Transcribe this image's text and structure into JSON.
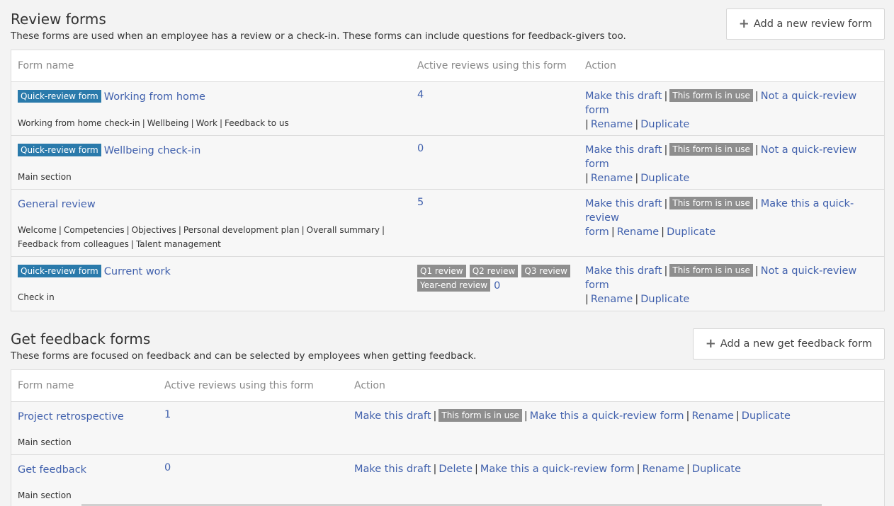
{
  "review": {
    "title": "Review forms",
    "description": "These forms are used when an employee has a review or a check-in. These forms can include questions for feedback-givers too.",
    "add_button": "Add a new review form",
    "headers": {
      "name": "Form name",
      "active": "Active reviews using this form",
      "action": "Action"
    },
    "rows": [
      {
        "badge": "Quick-review form",
        "name": "Working from home",
        "sections": [
          "Working from home check-in",
          "Wellbeing",
          "Work",
          "Feedback to us"
        ],
        "count": "4",
        "make_draft": "Make this draft",
        "in_use": "This form is in use",
        "quick": "Not a quick-review form",
        "rename": "Rename",
        "duplicate": "Duplicate"
      },
      {
        "badge": "Quick-review form",
        "name": "Wellbeing check-in",
        "sections": [
          "Main section"
        ],
        "count": "0",
        "make_draft": "Make this draft",
        "in_use": "This form is in use",
        "quick": "Not a quick-review form",
        "rename": "Rename",
        "duplicate": "Duplicate"
      },
      {
        "name": "General review",
        "sections_line1": [
          "Welcome",
          "Competencies",
          "Objectives",
          "Personal development plan",
          "Overall summary"
        ],
        "sections_line2": [
          "Feedback from colleagues",
          "Talent management"
        ],
        "count": "5",
        "make_draft": "Make this draft",
        "in_use": "This form is in use",
        "quick_part1": "Make this a quick-review",
        "quick_part2": "form",
        "rename": "Rename",
        "duplicate": "Duplicate"
      },
      {
        "badge": "Quick-review form",
        "name": "Current work",
        "sections": [
          "Check in"
        ],
        "cycles": [
          "Q1 review",
          "Q2 review",
          "Q3 review",
          "Year-end review"
        ],
        "count": "0",
        "make_draft": "Make this draft",
        "in_use": "This form is in use",
        "quick": "Not a quick-review form",
        "rename": "Rename",
        "duplicate": "Duplicate"
      }
    ]
  },
  "feedback": {
    "title": "Get feedback forms",
    "description": "These forms are focused on feedback and can be selected by employees when getting feedback.",
    "add_button": "Add a new get feedback form",
    "headers": {
      "name": "Form name",
      "active": "Active reviews using this form",
      "action": "Action"
    },
    "rows": [
      {
        "name": "Project retrospective",
        "sections": [
          "Main section"
        ],
        "count": "1",
        "make_draft": "Make this draft",
        "in_use": "This form is in use",
        "quick": "Make this a quick-review form",
        "rename": "Rename",
        "duplicate": "Duplicate"
      },
      {
        "name": "Get feedback",
        "sections": [
          "Main section"
        ],
        "count": "0",
        "make_draft": "Make this draft",
        "delete": "Delete",
        "quick": "Make this a quick-review form",
        "rename": "Rename",
        "duplicate": "Duplicate"
      }
    ]
  },
  "icons": {
    "add": "plus-icon"
  },
  "colors": {
    "link": "#4161ad",
    "quick_badge": "#2a7aab",
    "gray_badge": "#8e8e8e"
  }
}
